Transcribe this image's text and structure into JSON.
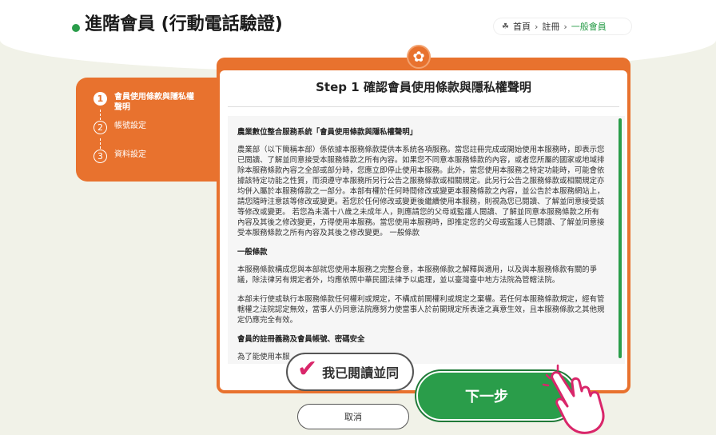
{
  "header": {
    "title": "進階會員 (行動電話驗證)",
    "breadcrumb": {
      "home_icon": "home-icon",
      "items": [
        "首頁",
        "註冊",
        "一般會員"
      ],
      "separator": "›"
    }
  },
  "stepper": {
    "steps": [
      {
        "number": "1",
        "label": "會員使用條款與隱私權聲明",
        "active": true
      },
      {
        "number": "2",
        "label": "帳號設定",
        "active": false
      },
      {
        "number": "3",
        "label": "資料設定",
        "active": false
      }
    ]
  },
  "card": {
    "emblem_icon": "flower-emblem-icon",
    "heading": "Step 1 確認會員使用條款與隱私權聲明"
  },
  "terms": {
    "doc_title": "農業數位整合服務系統「會員使用條款與隱私權聲明」",
    "intro": "農業部（以下簡稱本部）係依據本服務條款提供本系統各項服務。當您註冊完成或開始使用本服務時，即表示您已閱讀、了解並同意接受本服務條款之所有內容。如果您不同意本服務條款的內容，或者您所屬的國家或地域排除本服務條款內容之全部或部分時，您應立即停止使用本服務。此外，當您使用本服務之特定功能時，可能會依據該特定功能之性質，而須遵守本服務所另行公告之服務條款或相關規定。此另行公告之服務條款或相關規定亦均併入屬於本服務條款之一部分。本部有權於任何時間修改或變更本服務條款之內容，並公告於本服務網站上，請您隨時注意該等修改或變更。若您於任何修改或變更後繼續使用本服務，則視為您已閱讀、了解並同意接受該等修改或變更。 若您為未滿十八歲之未成年人，則應請您的父母或監護人閱讀、了解並同意本服務條款之所有內容及其後之修改變更，方得使用本服務。當您使用本服務時，即推定您的父母或監護人已閱讀、了解並同意接受本服務條款之所有內容及其後之修改變更。 一般條款",
    "section1_title": "一般條款",
    "section1_p1": "本服務條款構成您與本部就您使用本服務之完整合意，本服務條款之解釋與適用，以及與本服務條款有關的爭議，除法律另有規定者外，均應依照中華民國法律予以處理，並以臺灣臺中地方法院為管轄法院。",
    "section1_p2": "本部未行使或執行本服務條款任何權利或規定，不構成前開權利或規定之棄權。若任何本服務條款規定，經有管轄權之法院認定無效，當事人仍同意法院應努力使當事人於前開規定所表達之真意生效，且本服務條款之其他規定仍應完全有效。",
    "section2_title": "會員的註冊義務及會員帳號、密碼安全",
    "section2_partial": "為了能使用本服"
  },
  "actions": {
    "agree_label": "我已閱讀並同",
    "agree_check_icon": "checkmark-icon",
    "next_label": "下一步",
    "cancel_label": "取消",
    "pointer_icon": "pointing-hand-icon"
  },
  "colors": {
    "brand_green": "#2a9d4a",
    "brand_orange": "#e8722e",
    "title_highlight": "#b7de76",
    "check_pink": "#d9266a",
    "background": "#f1f2e8"
  }
}
